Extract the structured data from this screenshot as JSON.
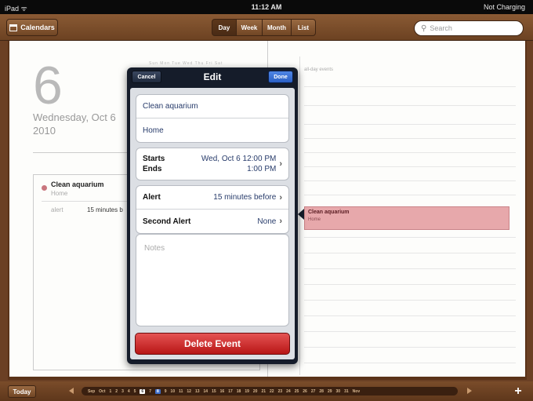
{
  "status_bar": {
    "carrier": "iPad ᯤ",
    "time": "11:12 AM",
    "battery": "Not Charging"
  },
  "toolbar": {
    "calendars_label": "Calendars",
    "views": [
      "Day",
      "Week",
      "Month",
      "List"
    ],
    "selected_view": "Day",
    "search_placeholder": "Search"
  },
  "left_page": {
    "day_number": "6",
    "weekday_date": "Wednesday, Oct 6",
    "year": "2010",
    "mini_calendar_header": "Sun Mon Tue Wed Thu Fri Sat",
    "event": {
      "title": "Clean aquarium",
      "location": "Home",
      "alert_key": "alert",
      "alert_value": "15 minutes b"
    }
  },
  "right_page": {
    "all_day_label": "all-day events",
    "event_title": "Clean aquarium",
    "event_location": "Home"
  },
  "popover": {
    "cancel_label": "Cancel",
    "title": "Edit",
    "done_label": "Done",
    "title_value": "Clean aquarium",
    "location_value": "Home",
    "starts_label": "Starts",
    "ends_label": "Ends",
    "starts_value": "Wed, Oct 6  12:00 PM",
    "ends_value": "1:00 PM",
    "alert_label": "Alert",
    "alert_value": "15 minutes before",
    "second_alert_label": "Second Alert",
    "second_alert_value": "None",
    "notes_placeholder": "Notes",
    "delete_label": "Delete Event"
  },
  "bottom_bar": {
    "today_label": "Today",
    "prev_month": "Sep",
    "month": "Oct",
    "days": [
      "1",
      "2",
      "3",
      "4",
      "5",
      "6",
      "7",
      "8",
      "9",
      "10",
      "11",
      "12",
      "13",
      "14",
      "15",
      "16",
      "17",
      "18",
      "19",
      "20",
      "21",
      "22",
      "23",
      "24",
      "25",
      "26",
      "27",
      "28",
      "29",
      "30",
      "31"
    ],
    "current_day": "6",
    "selected_day": "8",
    "next_month": "Nov",
    "add_label": "+"
  },
  "colors": {
    "wood": "#6b4024",
    "event_fill": "#e7a8ab",
    "delete_red": "#c41f1f",
    "done_blue": "#3a72d8"
  }
}
